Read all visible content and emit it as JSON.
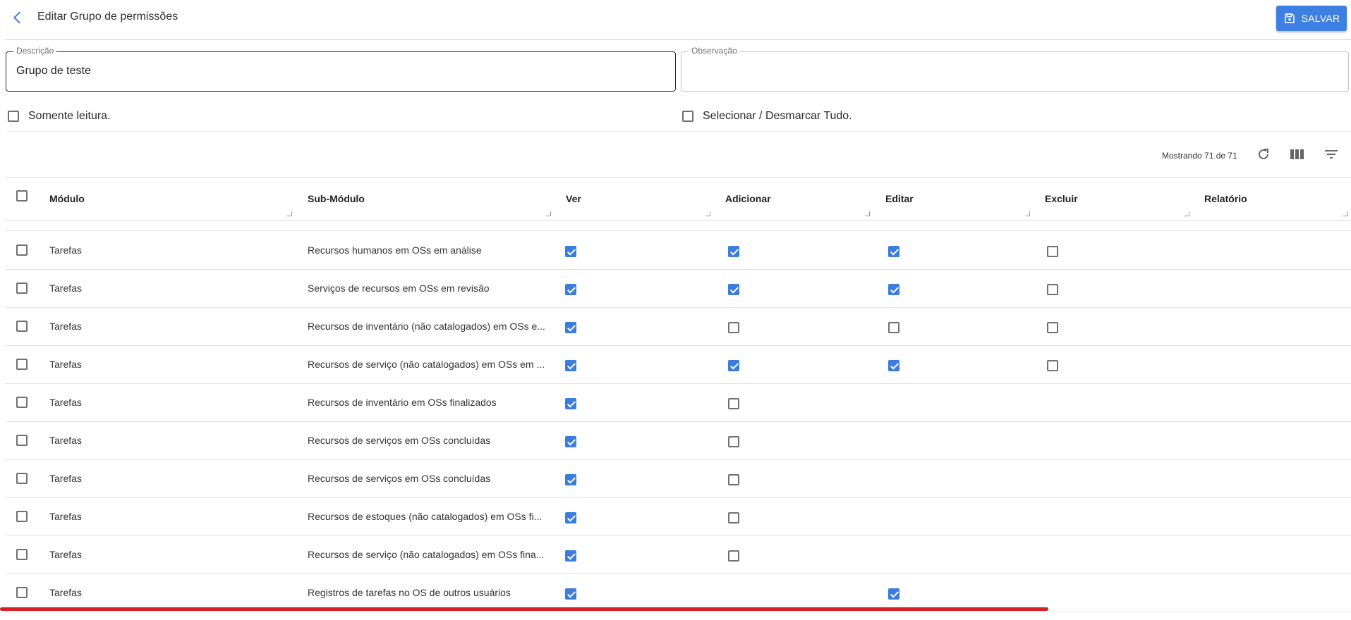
{
  "header": {
    "title": "Editar Grupo de permissões",
    "save_label": "SALVAR"
  },
  "form": {
    "description": {
      "label": "Descrição",
      "value": "Grupo de teste"
    },
    "observation": {
      "label": "Observação",
      "value": ""
    }
  },
  "options": {
    "read_only": {
      "label": "Somente leitura.",
      "checked": false
    },
    "select_all": {
      "label": "Selecionar / Desmarcar Tudo.",
      "checked": false
    }
  },
  "toolbar": {
    "showing": "Mostrando 71 de 71"
  },
  "table": {
    "columns": [
      "Módulo",
      "Sub-Módulo",
      "Ver",
      "Adicionar",
      "Editar",
      "Excluir",
      "Relatório"
    ],
    "rows": [
      {
        "modulo": "Tarefas",
        "submodulo": "Recursos humanos em OSs em análise",
        "ver": true,
        "adicionar": true,
        "editar": true,
        "excluir": false,
        "relatorio": null
      },
      {
        "modulo": "Tarefas",
        "submodulo": "Serviços de recursos em OSs em revisão",
        "ver": true,
        "adicionar": true,
        "editar": true,
        "excluir": false,
        "relatorio": null
      },
      {
        "modulo": "Tarefas",
        "submodulo": "Recursos de inventário (não catalogados) em OSs e...",
        "ver": true,
        "adicionar": false,
        "editar": false,
        "excluir": false,
        "relatorio": null
      },
      {
        "modulo": "Tarefas",
        "submodulo": "Recursos de serviço (não catalogados) em OSs em ...",
        "ver": true,
        "adicionar": true,
        "editar": true,
        "excluir": false,
        "relatorio": null
      },
      {
        "modulo": "Tarefas",
        "submodulo": "Recursos de inventário em OSs finalizados",
        "ver": true,
        "adicionar": false,
        "editar": null,
        "excluir": null,
        "relatorio": null
      },
      {
        "modulo": "Tarefas",
        "submodulo": "Recursos de serviços em OSs concluídas",
        "ver": true,
        "adicionar": false,
        "editar": null,
        "excluir": null,
        "relatorio": null
      },
      {
        "modulo": "Tarefas",
        "submodulo": "Recursos de serviços em OSs concluídas",
        "ver": true,
        "adicionar": false,
        "editar": null,
        "excluir": null,
        "relatorio": null
      },
      {
        "modulo": "Tarefas",
        "submodulo": "Recursos de estoques (não catalogados) em OSs fi...",
        "ver": true,
        "adicionar": false,
        "editar": null,
        "excluir": null,
        "relatorio": null
      },
      {
        "modulo": "Tarefas",
        "submodulo": "Recursos de serviço (não catalogados) em OSs fina...",
        "ver": true,
        "adicionar": false,
        "editar": null,
        "excluir": null,
        "relatorio": null
      },
      {
        "modulo": "Tarefas",
        "submodulo": "Registros de tarefas no OS de outros usuários",
        "ver": true,
        "adicionar": null,
        "editar": true,
        "excluir": null,
        "relatorio": null
      }
    ]
  },
  "colors": {
    "accent": "#3d7fe3",
    "checkbox_checked": "#3b7ddd",
    "scroll_highlight": "#d61f26"
  },
  "icons": [
    "chevron-left-icon",
    "save-icon",
    "refresh-icon",
    "columns-icon",
    "filter-icon"
  ]
}
